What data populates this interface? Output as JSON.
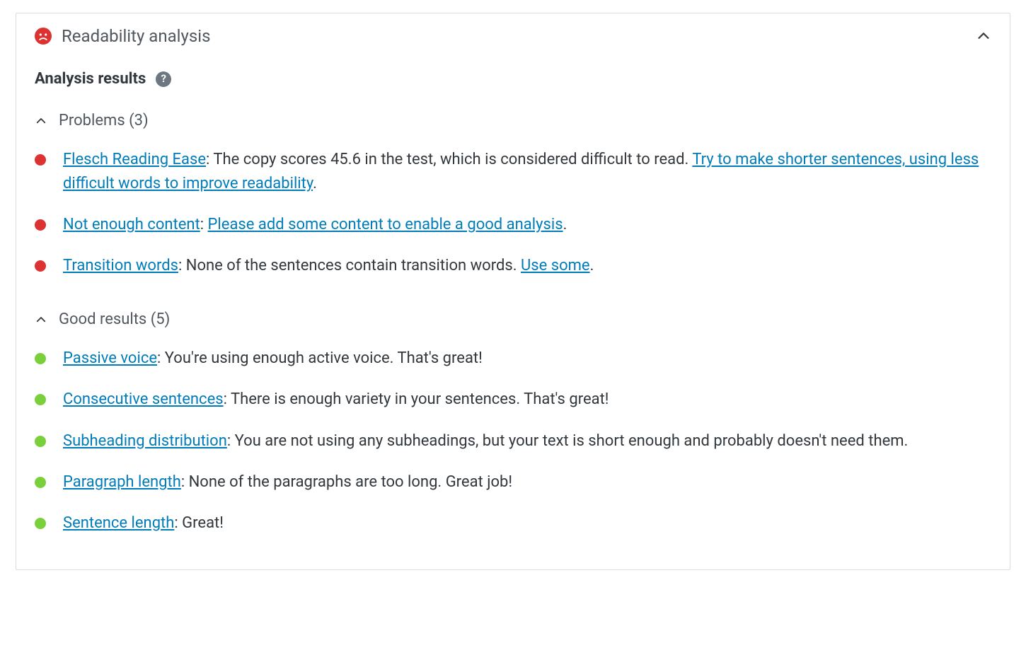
{
  "header": {
    "title": "Readability analysis"
  },
  "analysis_results": {
    "title": "Analysis results"
  },
  "groups": {
    "problems": {
      "label": "Problems (3)",
      "items": [
        {
          "link": "Flesch Reading Ease",
          "text_mid": ": The copy scores 45.6 in the test, which is considered difficult to read. ",
          "link2": "Try to make shorter sentences, using less difficult words to improve readability",
          "text_end": "."
        },
        {
          "link": "Not enough content",
          "text_mid": ": ",
          "link2": "Please add some content to enable a good analysis",
          "text_end": "."
        },
        {
          "link": "Transition words",
          "text_mid": ": None of the sentences contain transition words. ",
          "link2": "Use some",
          "text_end": "."
        }
      ]
    },
    "good": {
      "label": "Good results (5)",
      "items": [
        {
          "link": "Passive voice",
          "text": ": You're using enough active voice. That's great!"
        },
        {
          "link": "Consecutive sentences",
          "text": ": There is enough variety in your sentences. That's great!"
        },
        {
          "link": "Subheading distribution",
          "text": ": You are not using any subheadings, but your text is short enough and probably doesn't need them."
        },
        {
          "link": "Paragraph length",
          "text": ": None of the paragraphs are too long. Great job!"
        },
        {
          "link": "Sentence length",
          "text": ": Great!"
        }
      ]
    }
  }
}
